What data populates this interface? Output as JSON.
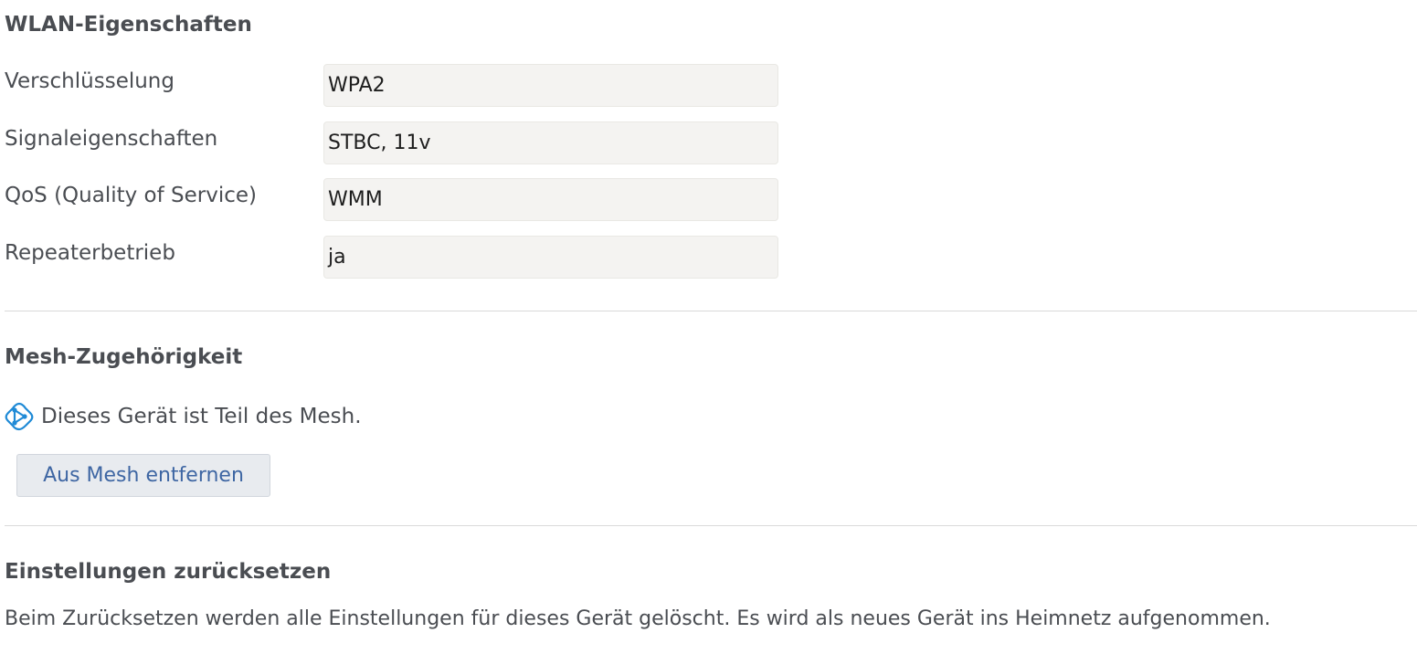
{
  "wlan": {
    "title": "WLAN-Eigenschaften",
    "rows": [
      {
        "label": "Verschlüsselung",
        "value": "WPA2"
      },
      {
        "label": "Signaleigenschaften",
        "value": "STBC, 11v"
      },
      {
        "label": "QoS (Quality of Service)",
        "value": "WMM"
      },
      {
        "label": "Repeaterbetrieb",
        "value": "ja"
      }
    ]
  },
  "mesh": {
    "title": "Mesh-Zugehörigkeit",
    "icon": "mesh-icon",
    "icon_color": "#1f8ad6",
    "status_text": "Dieses Gerät ist Teil des Mesh.",
    "button_label": "Aus Mesh entfernen"
  },
  "reset": {
    "title": "Einstellungen zurücksetzen",
    "description": "Beim Zurücksetzen werden alle Einstellungen für dieses Gerät gelöscht. Es wird als neues Gerät ins Heimnetz aufgenommen."
  }
}
